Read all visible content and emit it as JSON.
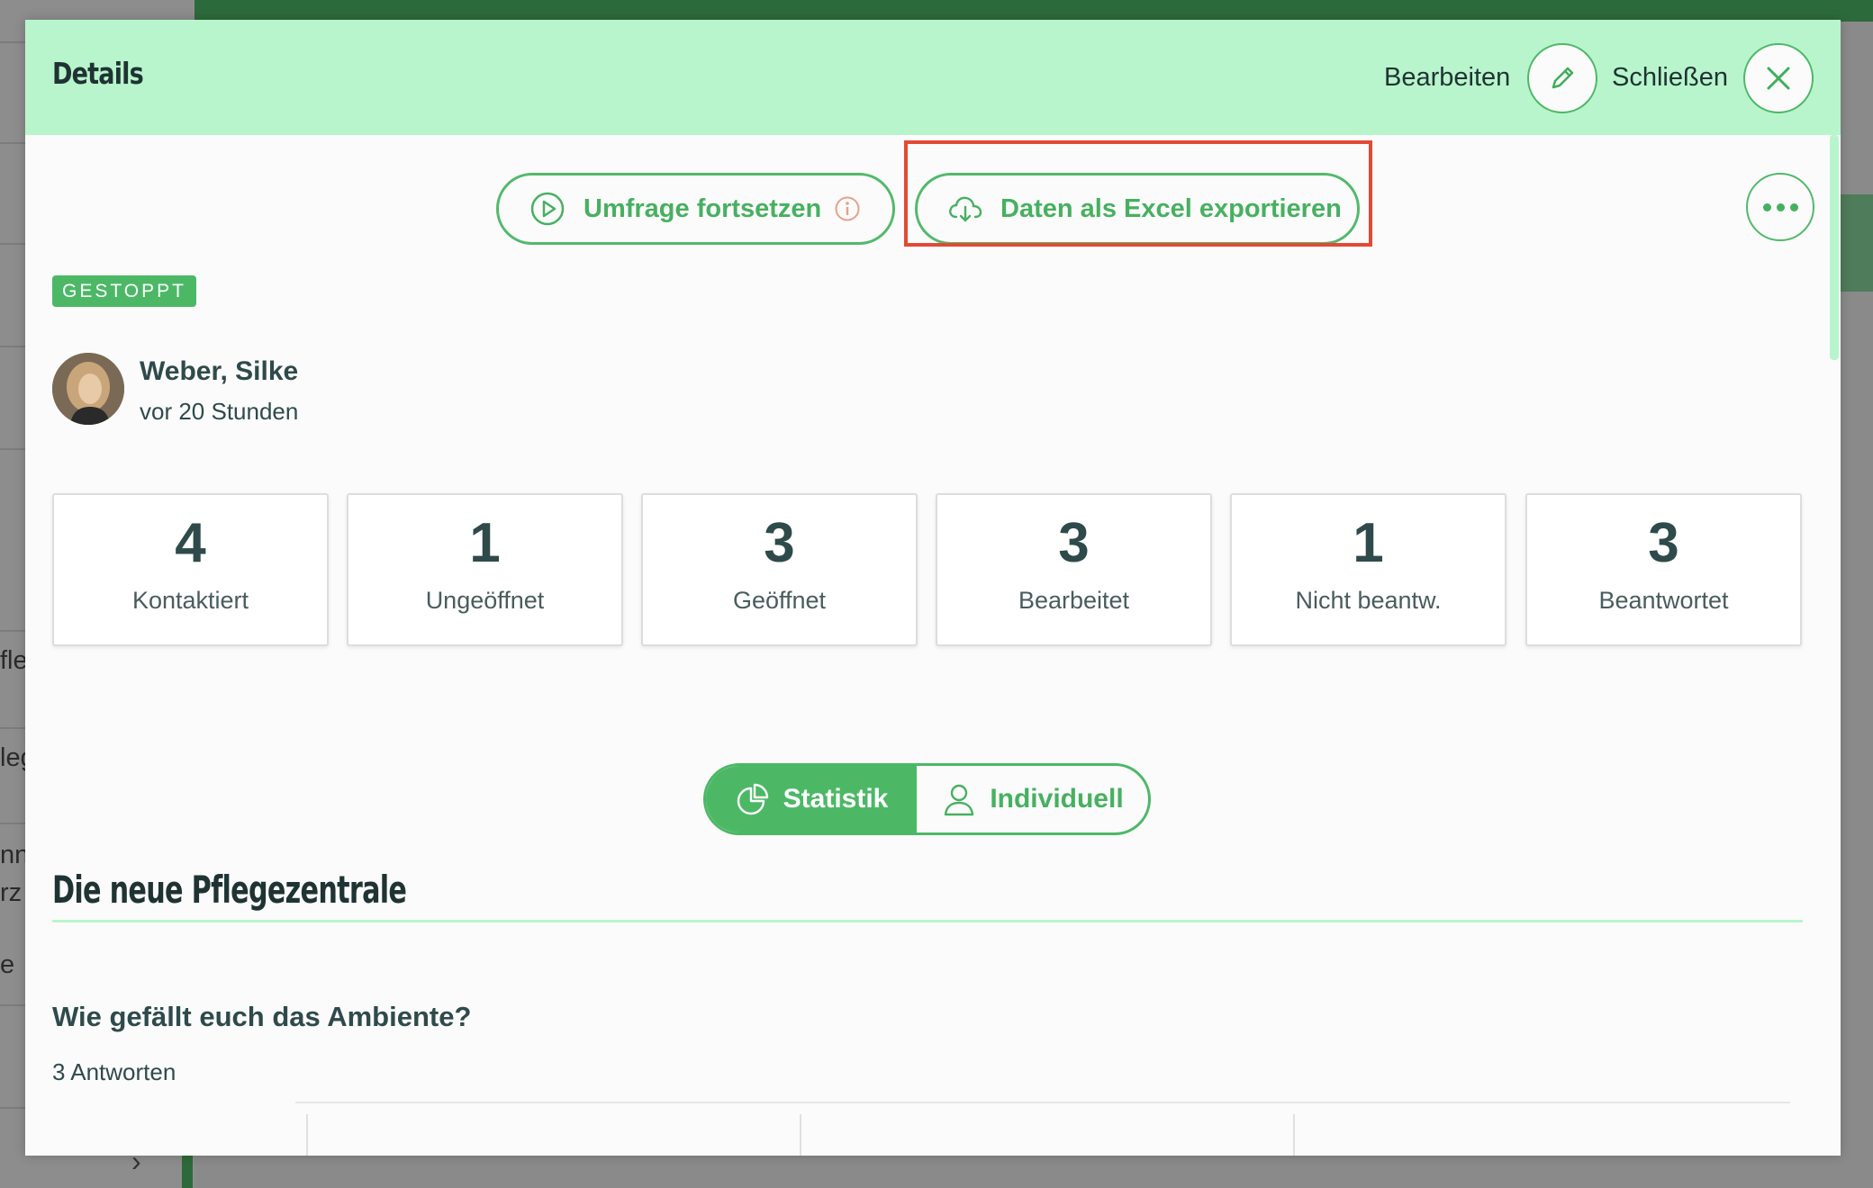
{
  "background": {
    "fragments": [
      "fle",
      "leg",
      "nna",
      "rz",
      "e"
    ]
  },
  "modal": {
    "title": "Details",
    "edit_label": "Bearbeiten",
    "close_label": "Schließen"
  },
  "actions": {
    "continue_label": "Umfrage fortsetzen",
    "export_label": "Daten als Excel exportieren"
  },
  "status_badge": "GESTOPPT",
  "author": {
    "name": "Weber, Silke",
    "time": "vor 20 Stunden"
  },
  "stats": [
    {
      "value": "4",
      "label": "Kontaktiert"
    },
    {
      "value": "1",
      "label": "Ungeöffnet"
    },
    {
      "value": "3",
      "label": "Geöffnet"
    },
    {
      "value": "3",
      "label": "Bearbeitet"
    },
    {
      "value": "1",
      "label": "Nicht beantw."
    },
    {
      "value": "3",
      "label": "Beantwortet"
    }
  ],
  "view_toggle": {
    "statistics_label": "Statistik",
    "individual_label": "Individuell",
    "active": "Statistik"
  },
  "survey": {
    "section_title": "Die neue Pflegezentrale",
    "question": "Wie gefällt euch das Ambiente?",
    "answer_count": "3 Antworten"
  },
  "colors": {
    "accent": "#4cb866",
    "header_bg": "#b8f5cc",
    "highlight": "#e24a35",
    "bar": "#a8c9ee"
  }
}
